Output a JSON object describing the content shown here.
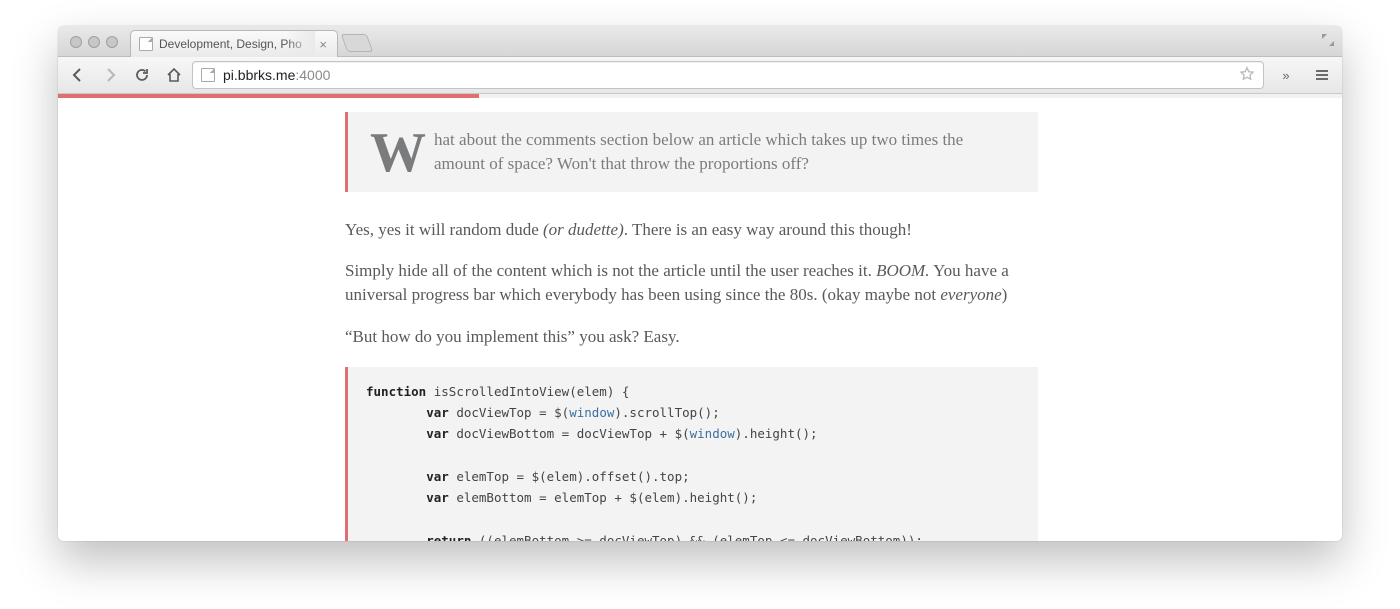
{
  "browser": {
    "tab_title": "Development, Design, Pho",
    "url_host": "pi.bbrks.me",
    "url_port": ":4000",
    "progress_percent": 32.8
  },
  "article": {
    "quote_dropcap": "W",
    "quote_text": "hat about the comments section below an article which takes up two times the amount of space? Won't that throw the proportions off?",
    "p1_a": "Yes, yes it will random dude ",
    "p1_em": "(or dudette)",
    "p1_b": ". There is an easy way around this though!",
    "p2_a": "Simply hide all of the content which is not the article until the user reaches it. ",
    "p2_em1": "BOOM.",
    "p2_b": " You have a universal progress bar which everybody has been using since the 80s. (okay maybe not ",
    "p2_em2": "everyone",
    "p2_c": ")",
    "p3": "“But how do you implement this” you ask? Easy."
  },
  "code": {
    "l1_kw": "function",
    "l1_rest": " isScrolledIntoView(elem) {",
    "l2_kw": "var",
    "l2_a": " docViewTop = $(",
    "l2_id": "window",
    "l2_b": ").scrollTop();",
    "l3_kw": "var",
    "l3_a": " docViewBottom = docViewTop + $(",
    "l3_id": "window",
    "l3_b": ").height();",
    "l4_kw": "var",
    "l4_rest": " elemTop = $(elem).offset().top;",
    "l5_kw": "var",
    "l5_rest": " elemBottom = elemTop + $(elem).height();",
    "l6_kw": "return",
    "l6_rest": " ((elemBottom >= docViewTop) && (elemTop <= docViewBottom));"
  }
}
